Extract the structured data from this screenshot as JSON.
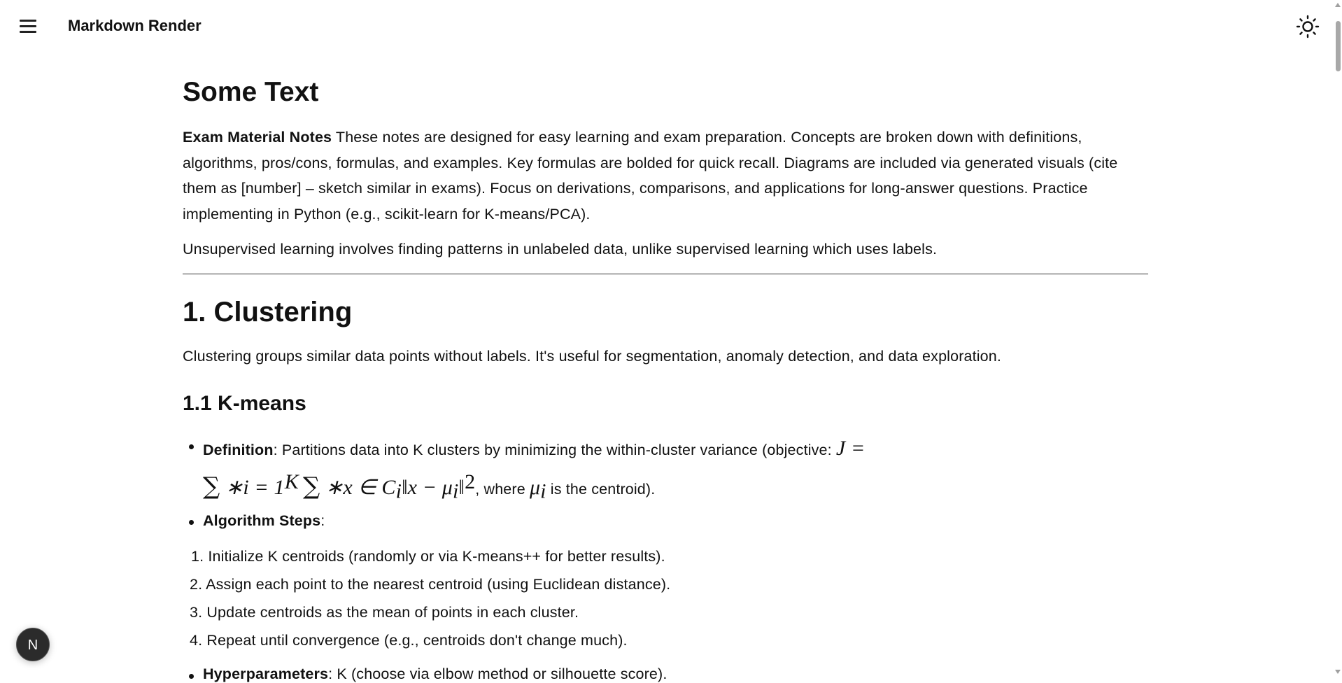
{
  "header": {
    "title": "Markdown Render",
    "menu_icon": "hamburger-icon",
    "theme_icon": "sun-icon"
  },
  "doc": {
    "h1": "Some Text",
    "intro_bold": "Exam Material Notes",
    "intro_text": " These notes are designed for easy learning and exam preparation. Concepts are broken down with definitions, algorithms, pros/cons, formulas, and examples. Key formulas are bolded for quick recall. Diagrams are included via generated visuals (cite them as [number] – sketch similar in exams). Focus on derivations, comparisons, and applications for long-answer questions. Practice implementing in Python (e.g., scikit-learn for K-means/PCA).",
    "intro2": "Unsupervised learning involves finding patterns in unlabeled data, unlike supervised learning which uses labels.",
    "h2": "1. Clustering",
    "clustering_text": "Clustering groups similar data points without labels. It's useful for segmentation, anomaly detection, and data exploration.",
    "h3": "1.1 K-means",
    "definition": {
      "label": "Definition",
      "text": ": Partitions data into K clusters by minimizing the within-cluster variance (objective: ",
      "math_J": "J =",
      "math_sum1": "∑",
      "math_i": " ∗i = 1",
      "math_K": "K",
      "math_sum2": "∑",
      "math_x": " ∗x ∈ C",
      "math_ci_sub": "i",
      "math_norm": "‖x − μ",
      "math_mu_sub": "i",
      "math_norm_close": "‖",
      "math_sq": "2",
      "where": ", where ",
      "mu": "μ",
      "mu_sub": "i",
      "tail": " is the centroid)."
    },
    "algorithm": {
      "label": "Algorithm Steps",
      "colon": ":",
      "steps": [
        "1. Initialize K centroids (randomly or via K-means++ for better results).",
        "2. Assign each point to the nearest centroid (using Euclidean distance).",
        "3. Update centroids as the mean of points in each cluster.",
        "4. Repeat until convergence (e.g., centroids don't change much)."
      ]
    },
    "hyper": {
      "label": "Hyperparameters",
      "text": ": K (choose via elbow method or silhouette score)."
    }
  },
  "badge": {
    "letter": "N"
  }
}
